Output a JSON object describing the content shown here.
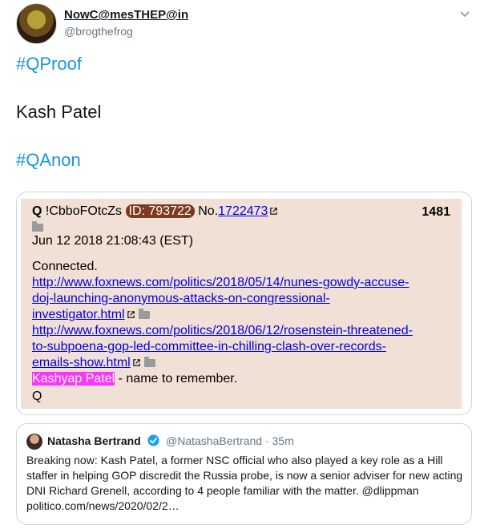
{
  "author": {
    "display_name": "NowC@mesTHEP@in",
    "handle": "@brogthefrog"
  },
  "tweet_lines": [
    "#QProof",
    "Kash Patel",
    "#QAnon"
  ],
  "qpost": {
    "name": "Q",
    "tripcode": "!CbboFOtcZs",
    "id_label": "ID: 793722",
    "no_label": "No.",
    "no_value": "1722473",
    "post_number": "1481",
    "date": "Jun 12 2018 21:08:43 (EST)",
    "body_line1": "Connected.",
    "link1_lines": [
      "http://www.foxnews.com/politics/2018/05/14/nunes-gowdy-accuse-",
      "doj-launching-anonymous-attacks-on-congressional-",
      "investigator.html"
    ],
    "link2_lines": [
      "http://www.foxnews.com/politics/2018/06/12/rosenstein-threatened-",
      "to-subpoena-gop-led-committee-in-chilling-clash-over-records-",
      "emails-show.html"
    ],
    "highlight": "Kashyap Patel",
    "highlight_suffix": " - name to remember.",
    "signature": "Q"
  },
  "quoted_tweet": {
    "name": "Natasha Bertrand",
    "handle_time": "@NatashaBertrand · 35m",
    "text": "Breaking now: Kash Patel, a former NSC official who also played a key role as a Hill staffer in helping GOP discredit the Russia probe, is now a senior adviser for new acting DNI Richard Grenell, according to 4 people familiar with the matter. @dlippman politico.com/news/2020/02/2…"
  },
  "icons": {
    "caret": "chevron-down-icon",
    "verified": "verified-badge-icon",
    "external": "external-link-icon",
    "folder": "folder-icon"
  },
  "colors": {
    "hashtag": "#1b95e0",
    "qpost_bg": "#f0e0d6",
    "id_badge": "#7d3a1f",
    "highlight": "#ff33ff",
    "link": "#0000ee",
    "verified": "#1da1f2"
  }
}
